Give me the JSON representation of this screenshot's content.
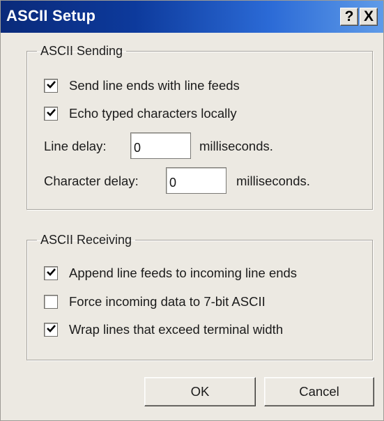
{
  "window": {
    "title": "ASCII Setup",
    "help_glyph": "?",
    "close_glyph": "X",
    "title_gradient": [
      "#0a2a7a",
      "#5f9be8"
    ]
  },
  "sending": {
    "legend": "ASCII Sending",
    "send_line_ends": {
      "label": "Send line ends with line feeds",
      "checked": true
    },
    "echo_locally": {
      "label": "Echo typed characters locally",
      "checked": true
    },
    "line_delay": {
      "label": "Line delay:",
      "value": "0",
      "unit": "milliseconds."
    },
    "char_delay": {
      "label": "Character delay:",
      "value": "0",
      "unit": "milliseconds."
    }
  },
  "receiving": {
    "legend": "ASCII Receiving",
    "append_line_feeds": {
      "label": "Append line feeds to incoming line ends",
      "checked": true
    },
    "force_7bit": {
      "label": "Force incoming data to 7-bit ASCII",
      "checked": false
    },
    "wrap_lines": {
      "label": "Wrap lines that exceed terminal width",
      "checked": true
    }
  },
  "buttons": {
    "ok": "OK",
    "cancel": "Cancel"
  }
}
